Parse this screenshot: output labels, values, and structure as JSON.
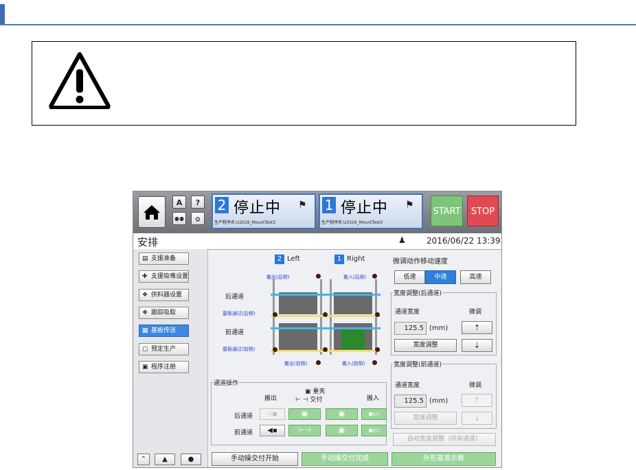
{
  "warning_icon": "warning-triangle-icon",
  "header": {
    "home_icon": "home-icon",
    "icon_a": "A",
    "icon_help": "?",
    "lane2": {
      "num": "2",
      "status": "停止中",
      "program": "生产程序名:U2S16_MountTest3"
    },
    "lane1": {
      "num": "1",
      "status": "停止中",
      "program": "生产程序名:U2S16_MountTest3"
    },
    "start_label": "START",
    "stop_label": "STOP"
  },
  "title": {
    "text": "安排",
    "datetime": "2016/06/22 13:39",
    "user_icon": "user-icon"
  },
  "sidebar": {
    "items": [
      {
        "label": "支援准备",
        "icon": "support-prep-icon",
        "active": false
      },
      {
        "label": "支援吸嘴设置",
        "icon": "nozzle-setting-icon",
        "active": false
      },
      {
        "label": "供料器设置",
        "icon": "feeder-icon",
        "active": false
      },
      {
        "label": "跟踪吸取",
        "icon": "tracking-icon",
        "active": false
      },
      {
        "label": "基板传送",
        "icon": "board-transfer-icon",
        "active": true
      },
      {
        "label": "预定生产",
        "icon": "schedule-icon",
        "active": false
      },
      {
        "label": "程序注册",
        "icon": "program-register-icon",
        "active": false
      }
    ],
    "bottom": [
      "≈",
      "▲",
      "❶"
    ]
  },
  "conveyor": {
    "left_num": "2",
    "left_label": "Left",
    "right_num": "1",
    "right_label": "Right",
    "out_rear": "搬出(后侧)",
    "in_rear": "搬入(后侧)",
    "out_front": "搬出(前侧)",
    "in_front": "搬入(前侧)",
    "rear_lane": "后通道",
    "rear_pass": "基板通过(后侧)",
    "front_lane": "前通道",
    "front_pass": "基板通过(前侧)"
  },
  "lane_ops": {
    "title": "通道操作",
    "col_out": "搬出",
    "col_clamp": "重夹",
    "col_handover": "交付",
    "col_in": "搬入",
    "row_rear": "后通道",
    "row_front": "前通道"
  },
  "speed": {
    "title": "微调动作移动速度",
    "low": "低速",
    "mid": "中速",
    "high": "高速",
    "selected": "中速"
  },
  "width_rear": {
    "title": "宽度调整(后通道)",
    "width_label": "通道宽度",
    "fine_label": "微调",
    "value": "125.5",
    "unit": "(mm)",
    "adjust": "宽度调整"
  },
  "width_front": {
    "title": "宽度调整(前通道)",
    "width_label": "通道宽度",
    "fine_label": "微调",
    "value": "125.5",
    "unit": "(mm)",
    "adjust": "宽度调整"
  },
  "auto_width": "自动宽度调整（所有通道）",
  "bottom": {
    "manual_start": "手动操交付开始",
    "manual_done": "手动操交付完成",
    "shape_ref": "外形基准示教"
  },
  "colors": {
    "accent": "#2f77d6",
    "start": "#7ec57a",
    "stop": "#e24a53",
    "rail_blue": "#3fb7e8",
    "rail_yellow": "#f3e07a"
  }
}
